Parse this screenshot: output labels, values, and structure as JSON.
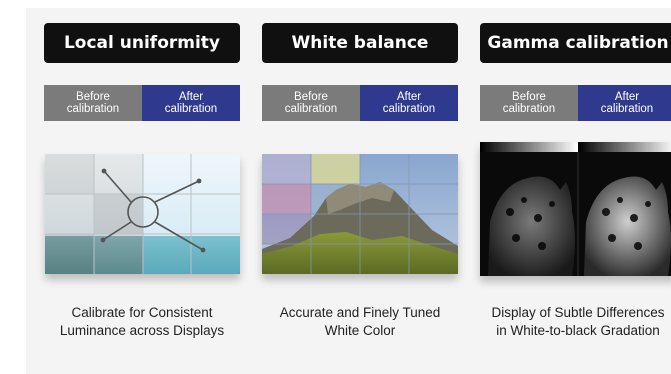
{
  "columns": [
    {
      "title": "Local uniformity",
      "before_label": "Before\ncalibration",
      "after_label": "After\ncalibration",
      "caption": "Calibrate for Consistent\nLuminance across Displays"
    },
    {
      "title": "White balance",
      "before_label": "Before\ncalibration",
      "after_label": "After\ncalibration",
      "caption": "Accurate and Finely Tuned\nWhite Color"
    },
    {
      "title": "Gamma calibration",
      "before_label": "Before\ncalibration",
      "after_label": "After\ncalibration",
      "caption": "Display of Subtle Differences\nin White-to-black Gradation"
    }
  ],
  "colors": {
    "panel_background": "#f4f4f4",
    "title_background": "#101010",
    "before_background": "#7b7b7b",
    "after_background": "#2f3a8f"
  },
  "images": {
    "local_uniformity": "video-wall-grid-image",
    "white_balance": "mountain-landscape-image",
    "gamma_calibration": "leopard-grayscale-image"
  }
}
